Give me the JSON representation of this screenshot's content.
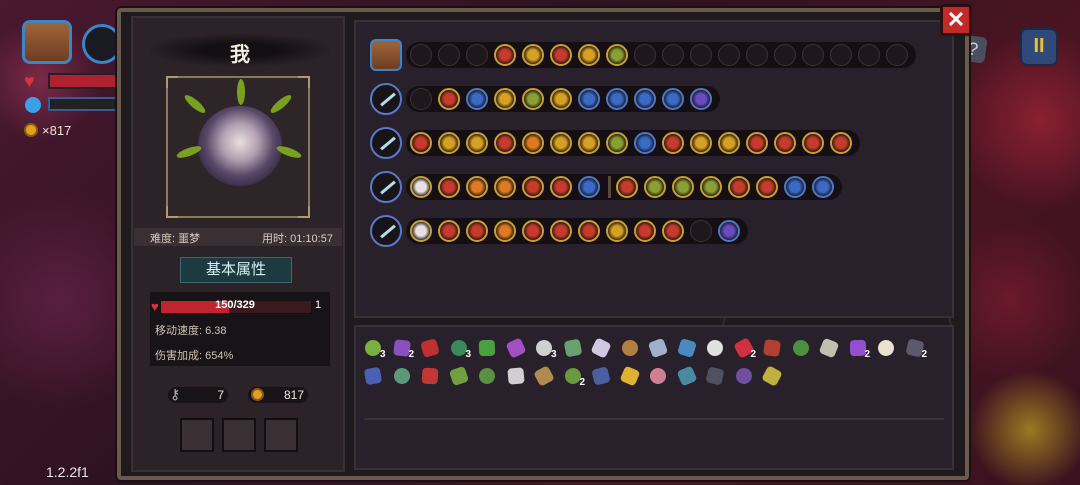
{
  "hud": {
    "coins": "×817",
    "help_label": "?",
    "pause_label": "II",
    "version": "1.2.2f1"
  },
  "panel": {
    "close_label": "✕"
  },
  "player": {
    "name": "我",
    "difficulty": "难度: 噩梦",
    "play_time": "用时: 01:10:57",
    "section_title": "基本属性",
    "hp": {
      "current": 150,
      "max": 329,
      "text": "150/329",
      "extra": "1"
    },
    "move_speed": "移动速度: 6.38",
    "damage_bonus": "伤害加成: 654%",
    "keys": "7",
    "gold": "817"
  },
  "colors": {
    "accent_gold": "#c8a030",
    "accent_blue": "#4a7ac8",
    "hp_red": "#c0242e",
    "panel_bg": "#1f1a1e"
  },
  "loadout": {
    "rows": [
      {
        "weapon": "treasure-chest-icon",
        "slots": [
          "e",
          "e",
          "e",
          "r",
          "y",
          "r",
          "y",
          "g",
          "e",
          "e",
          "e",
          "e",
          "e",
          "e",
          "e",
          "e",
          "e",
          "e"
        ]
      },
      {
        "weapon": "ice-sword-icon",
        "slots": [
          "e",
          "r",
          "b",
          "y",
          "g",
          "y",
          "b",
          "b",
          "b",
          "b",
          "p"
        ]
      },
      {
        "weapon": "star-staff-icon",
        "slots": [
          "r",
          "y",
          "y",
          "r",
          "o",
          "y",
          "y",
          "g",
          "b",
          "r",
          "y",
          "y",
          "r",
          "r",
          "r",
          "r"
        ]
      },
      {
        "weapon": "frost-staff-icon",
        "slots": [
          "w",
          "r",
          "o",
          "o",
          "r",
          "r",
          "b",
          "|",
          "r",
          "g",
          "g",
          "g",
          "r",
          "r",
          "b",
          "b"
        ]
      },
      {
        "weapon": "fire-staff-icon",
        "slots": [
          "w",
          "r",
          "r",
          "o",
          "r",
          "r",
          "r",
          "y",
          "r",
          "r",
          "e",
          "p"
        ]
      }
    ]
  },
  "inventory": {
    "items": [
      {
        "icon": "leaf-charm-icon",
        "color": "#7ab040",
        "count": "3"
      },
      {
        "icon": "wizard-hat-icon",
        "color": "#8a50c0",
        "count": "2"
      },
      {
        "icon": "red-book-icon",
        "color": "#c03030",
        "count": ""
      },
      {
        "icon": "green-scroll-icon",
        "color": "#3a8a5a",
        "count": "3"
      },
      {
        "icon": "plant-icon",
        "color": "#4aa040",
        "count": ""
      },
      {
        "icon": "purple-gem-icon",
        "color": "#a050c0",
        "count": ""
      },
      {
        "icon": "chest-icon",
        "color": "#d0d0d0",
        "count": "3"
      },
      {
        "icon": "serpent-icon",
        "color": "#6aa070",
        "count": ""
      },
      {
        "icon": "ghost-icon",
        "color": "#d0c8e0",
        "count": ""
      },
      {
        "icon": "pouch-icon",
        "color": "#b08040",
        "count": ""
      },
      {
        "icon": "key-icon",
        "color": "#a0b0c8",
        "count": ""
      },
      {
        "icon": "amulet-icon",
        "color": "#4a8ac0",
        "count": ""
      },
      {
        "icon": "skull-icon",
        "color": "#e0e0e0",
        "count": ""
      },
      {
        "icon": "red-orb-icon",
        "color": "#d03040",
        "count": "2"
      },
      {
        "icon": "rune-tablet-icon",
        "color": "#b04030",
        "count": ""
      },
      {
        "icon": "vine-icon",
        "color": "#4a9040",
        "count": ""
      },
      {
        "icon": "bone-icon",
        "color": "#c0c0b0",
        "count": ""
      },
      {
        "icon": "magic-hat-icon",
        "color": "#9050d0",
        "count": "2"
      },
      {
        "icon": "feather-icon",
        "color": "#e8e0d0",
        "count": ""
      },
      {
        "icon": "cloak-icon",
        "color": "#5a5a6a",
        "count": "2"
      },
      {
        "icon": "blue-rune-icon",
        "color": "#4a60b0",
        "count": ""
      },
      {
        "icon": "tentacle-icon",
        "color": "#5a9a7a",
        "count": ""
      },
      {
        "icon": "rose-icon",
        "color": "#c03838",
        "count": ""
      },
      {
        "icon": "herb-icon",
        "color": "#70a040",
        "count": ""
      },
      {
        "icon": "frog-icon",
        "color": "#5a9040",
        "count": ""
      },
      {
        "icon": "spine-icon",
        "color": "#d0d0d0",
        "count": ""
      },
      {
        "icon": "pickaxe-icon",
        "color": "#b08a50",
        "count": ""
      },
      {
        "icon": "green-book-icon",
        "color": "#6a9a40",
        "count": "2"
      },
      {
        "icon": "boot-icon",
        "color": "#4a60a0",
        "count": ""
      },
      {
        "icon": "cheese-icon",
        "color": "#e0b030",
        "count": ""
      },
      {
        "icon": "brain-icon",
        "color": "#d08090",
        "count": ""
      },
      {
        "icon": "mirror-icon",
        "color": "#4a8aa0",
        "count": ""
      },
      {
        "icon": "dark-orb-icon",
        "color": "#505060",
        "count": ""
      },
      {
        "icon": "cage-icon",
        "color": "#7050a0",
        "count": ""
      },
      {
        "icon": "chain-icon",
        "color": "#c0b040",
        "count": ""
      }
    ]
  }
}
